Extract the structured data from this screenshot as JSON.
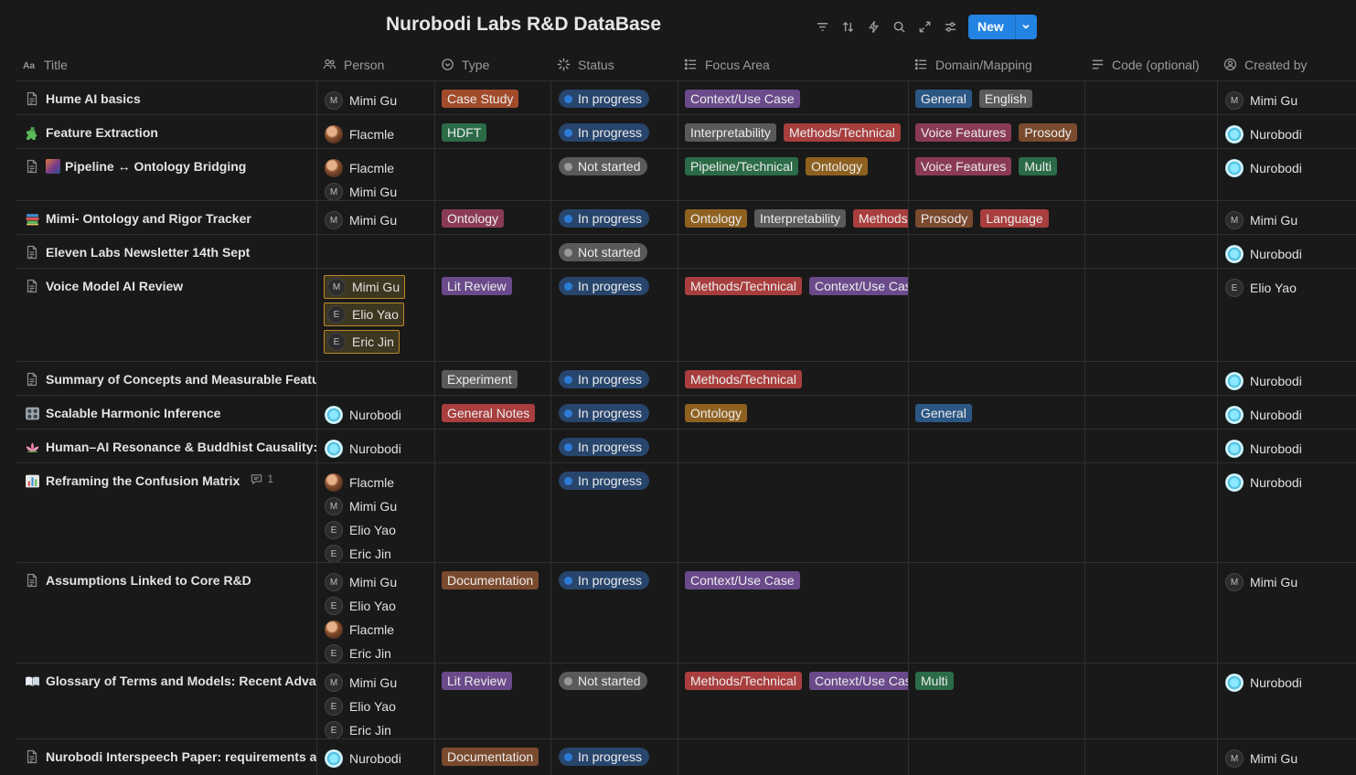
{
  "header": {
    "title": "Nurobodi Labs R&D DataBase",
    "new_label": "New",
    "tools": [
      "filter-icon",
      "sort-icon",
      "lightning-icon",
      "search-icon",
      "expand-icon",
      "settings-sliders-icon"
    ]
  },
  "columns": [
    {
      "label": "Title",
      "icon": "text-aa-icon"
    },
    {
      "label": "Person",
      "icon": "people-icon"
    },
    {
      "label": "Type",
      "icon": "select-circle-icon"
    },
    {
      "label": "Status",
      "icon": "status-spinner-icon"
    },
    {
      "label": "Focus Area",
      "icon": "list-icon"
    },
    {
      "label": "Domain/Mapping",
      "icon": "list-icon"
    },
    {
      "label": "Code (optional)",
      "icon": "text-lines-icon"
    },
    {
      "label": "Created by",
      "icon": "user-circle-icon"
    }
  ],
  "colors": {
    "brown": "#8a4e2e",
    "green": "#2b6b47",
    "purple": "#6a4a8a",
    "red": "#a83e3e",
    "orange": "#8f6121",
    "gray": "#5a5a5a",
    "blue": "#2b5784",
    "in_progress_bg": "#28456c",
    "not_started_bg": "#5a5a5a",
    "accent": "#2383e2"
  },
  "rows": [
    {
      "title": "Hume AI basics",
      "icon": "page-icon",
      "people": [
        {
          "name": "Mimi Gu",
          "initial": "M"
        }
      ],
      "type": {
        "label": "Case Study",
        "color": "#a14b2a"
      },
      "status": {
        "label": "In progress",
        "kind": "inprog"
      },
      "focus": [
        {
          "label": "Context/Use Case",
          "color": "#6a4a8a"
        }
      ],
      "domain": [
        {
          "label": "General",
          "color": "#2b5784"
        },
        {
          "label": "English",
          "color": "#5a5a5a"
        }
      ],
      "created_by": {
        "name": "Mimi Gu",
        "initial": "M"
      }
    },
    {
      "title": "Feature Extraction",
      "icon": "puzzle-icon",
      "people": [
        {
          "name": "Flacmle",
          "initial": "",
          "photo": true
        }
      ],
      "type": {
        "label": "HDFT",
        "color": "#2b6b47"
      },
      "status": {
        "label": "In progress",
        "kind": "inprog"
      },
      "focus": [
        {
          "label": "Interpretability",
          "color": "#5a5a5a"
        },
        {
          "label": "Methods/Technical",
          "color": "#a83e3e"
        }
      ],
      "domain": [
        {
          "label": "Voice Features",
          "color": "#8a3a57"
        },
        {
          "label": "Prosody",
          "color": "#7a4a2e"
        }
      ],
      "created_by": {
        "name": "Nurobodi",
        "logo": true
      }
    },
    {
      "title": "Pipeline ↔ Ontology Bridging",
      "icon": "page-icon",
      "emoji": "picture",
      "people": [
        {
          "name": "Flacmle",
          "initial": "",
          "photo": true
        },
        {
          "name": "Mimi Gu",
          "initial": "M"
        }
      ],
      "type": null,
      "status": {
        "label": "Not started",
        "kind": "notstart"
      },
      "focus": [
        {
          "label": "Pipeline/Technical",
          "color": "#2b6b47"
        },
        {
          "label": "Ontology",
          "color": "#8f6121"
        }
      ],
      "domain": [
        {
          "label": "Voice Features",
          "color": "#8a3a57"
        },
        {
          "label": "Multi",
          "color": "#2b6b47"
        }
      ],
      "created_by": {
        "name": "Nurobodi",
        "logo": true
      }
    },
    {
      "title": "Mimi- Ontology and Rigor Tracker",
      "icon": "books-icon",
      "people": [
        {
          "name": "Mimi Gu",
          "initial": "M"
        }
      ],
      "type": {
        "label": "Ontology",
        "color": "#8a3a57"
      },
      "status": {
        "label": "In progress",
        "kind": "inprog"
      },
      "focus": [
        {
          "label": "Ontology",
          "color": "#8f6121"
        },
        {
          "label": "Interpretability",
          "color": "#5a5a5a"
        },
        {
          "label": "Methods/Technical",
          "color": "#a83e3e"
        }
      ],
      "domain": [
        {
          "label": "Prosody",
          "color": "#7a4a2e"
        },
        {
          "label": "Language",
          "color": "#a83e3e"
        }
      ],
      "created_by": {
        "name": "Mimi Gu",
        "initial": "M"
      }
    },
    {
      "title": "Eleven Labs Newsletter 14th Sept",
      "icon": "page-icon",
      "people": [],
      "type": null,
      "status": {
        "label": "Not started",
        "kind": "notstart"
      },
      "focus": [],
      "domain": [],
      "created_by": {
        "name": "Nurobodi",
        "logo": true
      }
    },
    {
      "title": "Voice Model AI Review",
      "icon": "page-icon",
      "selected_people": true,
      "people": [
        {
          "name": "Mimi Gu",
          "initial": "M"
        },
        {
          "name": "Elio Yao",
          "initial": "E"
        },
        {
          "name": "Eric Jin",
          "initial": "E"
        }
      ],
      "type": {
        "label": "Lit Review",
        "color": "#6a4a8a"
      },
      "status": {
        "label": "In progress",
        "kind": "inprog"
      },
      "focus": [
        {
          "label": "Methods/Technical",
          "color": "#a83e3e"
        },
        {
          "label": "Context/Use Case",
          "color": "#6a4a8a"
        }
      ],
      "domain": [],
      "created_by": {
        "name": "Elio Yao",
        "initial": "E"
      }
    },
    {
      "title": "Summary of Concepts and Measurable Features",
      "icon": "page-icon",
      "people": [],
      "type": {
        "label": "Experiment",
        "color": "#5a5a5a"
      },
      "status": {
        "label": "In progress",
        "kind": "inprog"
      },
      "focus": [
        {
          "label": "Methods/Technical",
          "color": "#a83e3e"
        }
      ],
      "domain": [],
      "created_by": {
        "name": "Nurobodi",
        "logo": true
      }
    },
    {
      "title": "Scalable Harmonic Inference",
      "icon": "control-knobs-icon",
      "people": [
        {
          "name": "Nurobodi",
          "logo": true
        }
      ],
      "type": {
        "label": "General Notes",
        "color": "#a83e3e"
      },
      "status": {
        "label": "In progress",
        "kind": "inprog"
      },
      "focus": [
        {
          "label": "Ontology",
          "color": "#8f6121"
        }
      ],
      "domain": [
        {
          "label": "General",
          "color": "#2b5784"
        }
      ],
      "created_by": {
        "name": "Nurobodi",
        "logo": true
      }
    },
    {
      "title": "Human–AI Resonance & Buddhist Causality: Interdependence",
      "icon": "lotus-icon",
      "people": [
        {
          "name": "Nurobodi",
          "logo": true
        }
      ],
      "type": null,
      "status": {
        "label": "In progress",
        "kind": "inprog"
      },
      "focus": [],
      "domain": [],
      "created_by": {
        "name": "Nurobodi",
        "logo": true
      }
    },
    {
      "title": "Reframing the Confusion Matrix",
      "icon": "bar-chart-icon",
      "comment_count": "1",
      "people": [
        {
          "name": "Flacmle",
          "initial": "",
          "photo": true
        },
        {
          "name": "Mimi Gu",
          "initial": "M"
        },
        {
          "name": "Elio Yao",
          "initial": "E"
        },
        {
          "name": "Eric Jin",
          "initial": "E"
        }
      ],
      "type": null,
      "status": {
        "label": "In progress",
        "kind": "inprog"
      },
      "focus": [],
      "domain": [],
      "created_by": {
        "name": "Nurobodi",
        "logo": true
      }
    },
    {
      "title": "Assumptions Linked to Core R&D",
      "icon": "page-icon",
      "people": [
        {
          "name": "Mimi Gu",
          "initial": "M"
        },
        {
          "name": "Elio Yao",
          "initial": "E"
        },
        {
          "name": "Flacmle",
          "initial": "",
          "photo": true
        },
        {
          "name": "Eric Jin",
          "initial": "E"
        }
      ],
      "type": {
        "label": "Documentation",
        "color": "#7a4a2e"
      },
      "status": {
        "label": "In progress",
        "kind": "inprog"
      },
      "focus": [
        {
          "label": "Context/Use Case",
          "color": "#6a4a8a"
        }
      ],
      "domain": [],
      "created_by": {
        "name": "Mimi Gu",
        "initial": "M"
      }
    },
    {
      "title": "Glossary of Terms and Models: Recent Advances",
      "icon": "open-book-icon",
      "people": [
        {
          "name": "Mimi Gu",
          "initial": "M"
        },
        {
          "name": "Elio Yao",
          "initial": "E"
        },
        {
          "name": "Eric Jin",
          "initial": "E"
        }
      ],
      "type": {
        "label": "Lit Review",
        "color": "#6a4a8a"
      },
      "status": {
        "label": "Not started",
        "kind": "notstart"
      },
      "focus": [
        {
          "label": "Methods/Technical",
          "color": "#a83e3e"
        },
        {
          "label": "Context/Use Case",
          "color": "#6a4a8a"
        }
      ],
      "domain": [
        {
          "label": "Multi",
          "color": "#2b6b47"
        }
      ],
      "created_by": {
        "name": "Nurobodi",
        "logo": true
      }
    },
    {
      "title": "Nurobodi Interspeech Paper: requirements and",
      "icon": "page-icon",
      "people": [
        {
          "name": "Nurobodi",
          "logo": true
        }
      ],
      "type": {
        "label": "Documentation",
        "color": "#7a4a2e"
      },
      "status": {
        "label": "In progress",
        "kind": "inprog"
      },
      "focus": [],
      "domain": [],
      "created_by": {
        "name": "Mimi Gu",
        "initial": "M"
      }
    }
  ]
}
